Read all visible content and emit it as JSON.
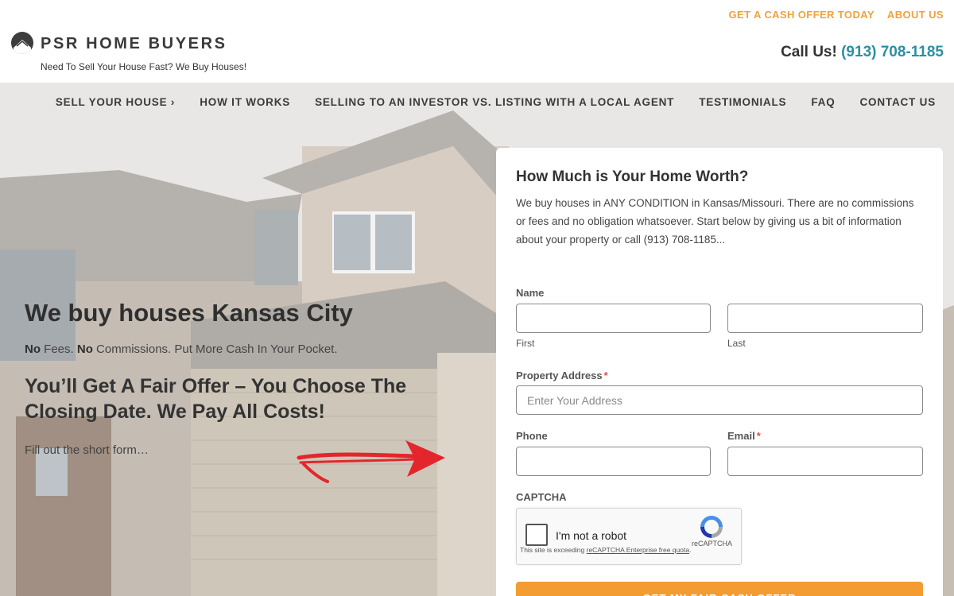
{
  "header": {
    "top_links": [
      "GET A CASH OFFER TODAY",
      "ABOUT US"
    ],
    "brand": "PSR HOME BUYERS",
    "tagline": "Need To Sell Your House Fast? We Buy Houses!",
    "call_label": "Call Us!",
    "phone": "(913) 708-1185",
    "logo_icon": "house-roof-icon"
  },
  "nav": {
    "items": [
      "SELL YOUR HOUSE ›",
      "HOW IT WORKS",
      "SELLING TO AN INVESTOR VS. LISTING WITH A LOCAL AGENT",
      "TESTIMONIALS",
      "FAQ",
      "CONTACT US"
    ]
  },
  "hero": {
    "title": "We buy houses Kansas City",
    "sub_no1": "No",
    "sub_text1": " Fees. ",
    "sub_no2": "No",
    "sub_text2": " Commissions. Put More Cash In Your Pocket.",
    "headline": "You’ll Get A Fair Offer – You Choose The Closing Date. We Pay All Costs!",
    "note": "Fill out the short form…",
    "arrow_icon": "red-arrow-icon"
  },
  "form": {
    "title": "How Much is Your Home Worth?",
    "description": "We buy houses in ANY CONDITION in Kansas/Missouri. There are no commissions or fees and no obligation whatsoever. Start below by giving us a bit of information about your property or call (913) 708-1185...",
    "name_label": "Name",
    "first_label": "First",
    "last_label": "Last",
    "address_label": "Property Address",
    "address_placeholder": "Enter Your Address",
    "phone_label": "Phone",
    "email_label": "Email",
    "required_mark": "*",
    "captcha_label": "CAPTCHA",
    "captcha_checkbox_text": "I'm not a robot",
    "captcha_brand": "reCAPTCHA",
    "captcha_warning_prefix": "This site is exceeding ",
    "captcha_warning_link": "reCAPTCHA Enterprise free quota",
    "captcha_warning_suffix": ".",
    "submit_label": "GET MY FAIR CASH OFFER"
  },
  "colors": {
    "accent_orange": "#f0a23b",
    "phone_teal": "#2a8fa5",
    "button_orange": "#f39c32",
    "required_red": "#e24b4b"
  }
}
